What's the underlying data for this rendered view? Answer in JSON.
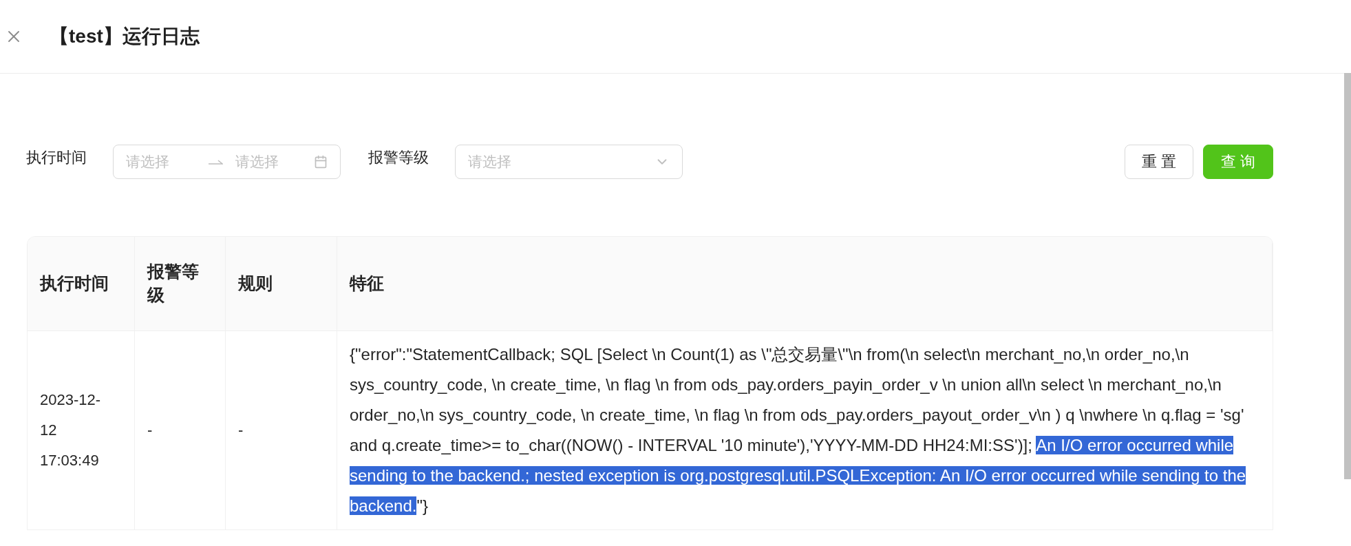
{
  "header": {
    "title": "【test】运行日志"
  },
  "filters": [
    {
      "kind": "daterange",
      "label": "执行时间",
      "start_placeholder": "请选择",
      "end_placeholder": "请选择"
    },
    {
      "kind": "select",
      "label": "报警等级",
      "placeholder": "请选择"
    }
  ],
  "buttons": [
    {
      "label": "重置",
      "kind": "default"
    },
    {
      "label": "查询",
      "kind": "primary"
    }
  ],
  "table": {
    "columns": [
      "执行时间",
      "报警等级",
      "规则",
      "特征"
    ],
    "rows": [
      {
        "time": "2023-12-12 17:03:49",
        "level": "-",
        "rule": "-",
        "feature": [
          {
            "text": "{\"error\":\"StatementCallback; SQL [Select \\n Count(1) as \\\"总交易量\\\"\\n from(\\n select\\n merchant_no,\\n order_no,\\n sys_country_code, \\n create_time, \\n flag \\n from ods_pay.orders_payin_order_v \\n union all\\n select \\n merchant_no,\\n order_no,\\n sys_country_code, \\n create_time, \\n flag \\n from ods_pay.orders_payout_order_v\\n ) q \\nwhere \\n q.flag = 'sg' and q.create_time>= to_char((NOW() - INTERVAL '10 minute'),'YYYY-MM-DD HH24:MI:SS')]; ",
            "highlighted": false
          },
          {
            "text": "An I/O error occurred while sending to the backend.; nested exception is org.postgresql.util.PSQLException: An I/O error occurred while sending to the backend.",
            "highlighted": true
          },
          {
            "text": "\"}",
            "highlighted": false
          }
        ]
      }
    ]
  }
}
